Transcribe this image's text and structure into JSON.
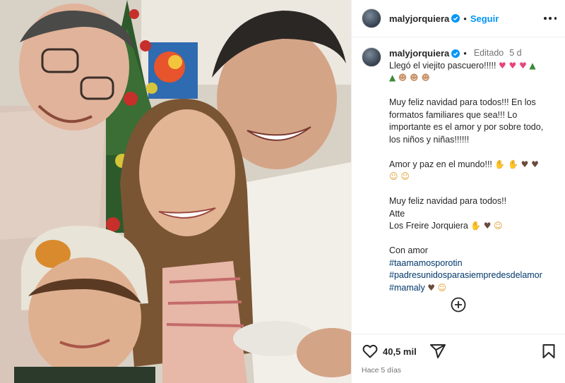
{
  "post": {
    "username": "malyjorquiera",
    "follow_label": "Seguir",
    "separator": "•",
    "edited_label": "Editado",
    "edited_separator": "•",
    "age": "5 d",
    "caption": {
      "line1": "Llegó el viejito pascuero!!!!!",
      "para1_1": "Muy feliz navidad para todos!!! En los",
      "para1_2": "formatos familiares que sea!!! Lo",
      "para1_3": "importante es el amor y por sobre todo,",
      "para1_4": "los niños y niñas!!!!!!",
      "para2": "Amor y paz en el mundo!!!",
      "para3_1": "Muy feliz navidad para todos!!",
      "para3_2": "Atte",
      "para3_3": "Los Freire Jorquiera",
      "para4": "Con amor",
      "tags": [
        "#taamamosporotin",
        "#padresunidosparasiempredesdelamor",
        "#mamaly"
      ]
    },
    "likes": "40,5 mil",
    "timestamp": "Hace 5 días"
  },
  "icons": {
    "verified": "verified-badge-icon",
    "more": "more-options-icon",
    "load_more": "plus-circle-icon",
    "like": "heart-icon",
    "share": "share-icon",
    "save": "bookmark-icon"
  },
  "colors": {
    "accent": "#0095f6",
    "hashtag": "#00376b",
    "secondary_text": "#737373",
    "verified": "#0095f6"
  }
}
